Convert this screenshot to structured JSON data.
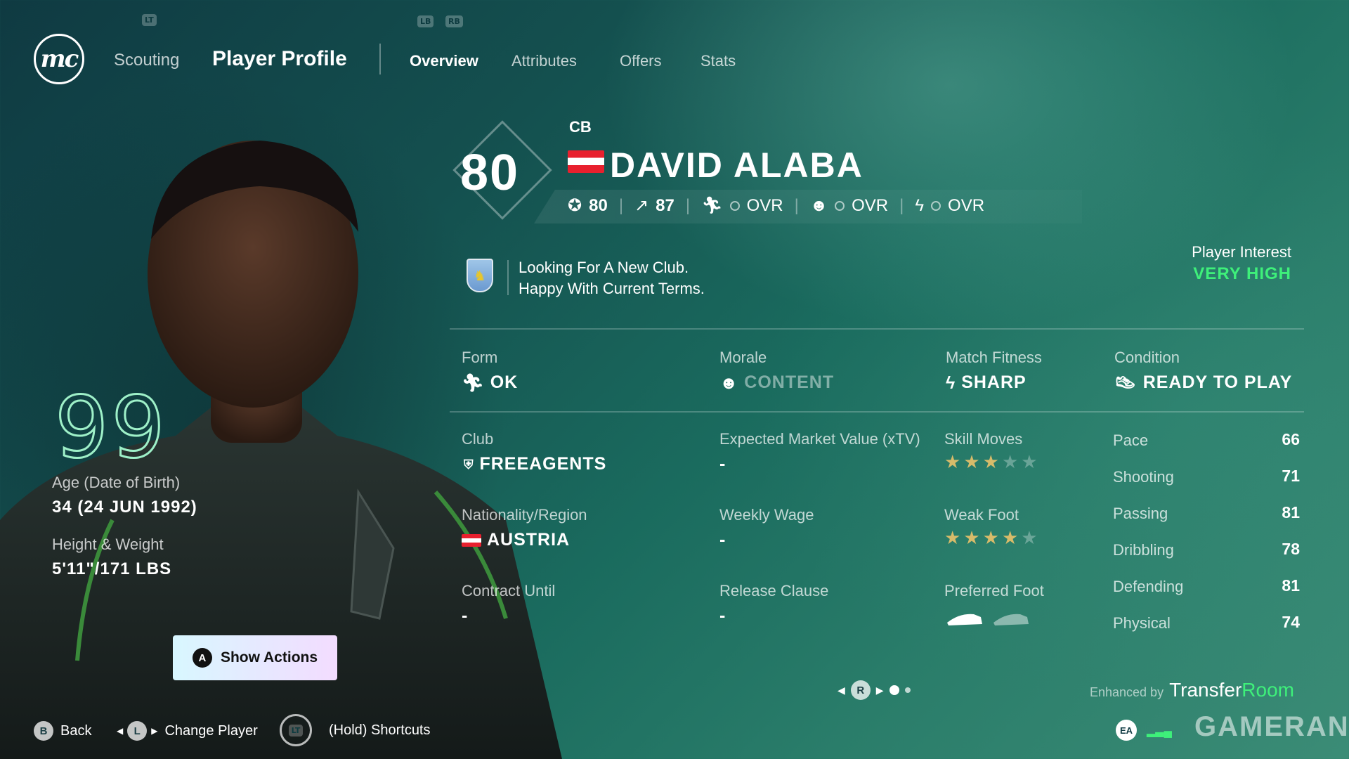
{
  "nav": {
    "logo": "mc",
    "lt_hint": "LT",
    "lb_hint": "LB",
    "rb_hint": "RB",
    "scouting": "Scouting",
    "player_profile": "Player Profile",
    "tabs": [
      "Overview",
      "Attributes",
      "Offers",
      "Stats"
    ],
    "active_tab": "Overview"
  },
  "player": {
    "rating": "80",
    "position": "CB",
    "name": "DAVID ALABA",
    "overall": "80",
    "potential": "87",
    "ovr_label": "OVR",
    "age_label": "Age (Date of Birth)",
    "age_value": "34 (24 JUN 1992)",
    "hw_label": "Height & Weight",
    "hw_value": "5'11\"/171 LBS",
    "big_number": "99"
  },
  "status": {
    "line1": "Looking For A New Club.",
    "line2": "Happy With Current Terms.",
    "interest_label": "Player Interest",
    "interest_value": "VERY HIGH"
  },
  "condition": {
    "form_label": "Form",
    "form_value": "OK",
    "morale_label": "Morale",
    "morale_value": "CONTENT",
    "fitness_label": "Match Fitness",
    "fitness_value": "SHARP",
    "condition_label": "Condition",
    "condition_value": "READY TO PLAY"
  },
  "details": {
    "club_label": "Club",
    "club_value": "FREEAGENTS",
    "nation_label": "Nationality/Region",
    "nation_value": "AUSTRIA",
    "contract_label": "Contract Until",
    "contract_value": "-",
    "xtv_label": "Expected Market Value (xTV)",
    "xtv_value": "-",
    "wage_label": "Weekly Wage",
    "wage_value": "-",
    "release_label": "Release Clause",
    "release_value": "-",
    "skill_label": "Skill Moves",
    "skill_stars": 3,
    "weak_label": "Weak Foot",
    "weak_stars": 4,
    "foot_label": "Preferred Foot"
  },
  "attributes": [
    {
      "label": "Pace",
      "value": "66"
    },
    {
      "label": "Shooting",
      "value": "71"
    },
    {
      "label": "Passing",
      "value": "81"
    },
    {
      "label": "Dribbling",
      "value": "78"
    },
    {
      "label": "Defending",
      "value": "81"
    },
    {
      "label": "Physical",
      "value": "74"
    }
  ],
  "actions": {
    "show_actions_key": "A",
    "show_actions": "Show Actions"
  },
  "footer": {
    "back_key": "B",
    "back": "Back",
    "change_key": "L",
    "change": "Change Player",
    "shortcuts_key": "LT",
    "shortcuts": "(Hold) Shortcuts",
    "pager_key": "R",
    "enhanced_by": "Enhanced by",
    "brand_a": "Transfer",
    "brand_b": "Room",
    "ea": "EA",
    "watermark": "GAMERANT"
  },
  "colors": {
    "accent_green": "#3ef07a",
    "star_gold": "#d7bb6a",
    "austria_red": "#e8202e"
  }
}
